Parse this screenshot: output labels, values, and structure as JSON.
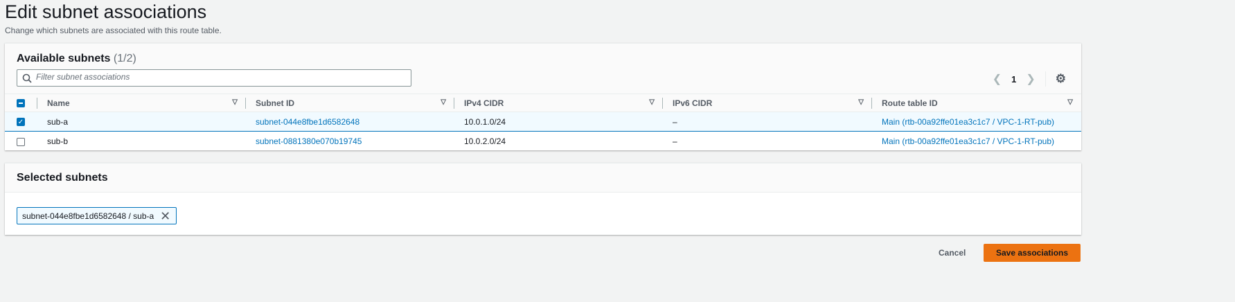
{
  "page": {
    "title": "Edit subnet associations",
    "description": "Change which subnets are associated with this route table."
  },
  "available": {
    "title": "Available subnets",
    "count": "(1/2)",
    "search_placeholder": "Filter subnet associations",
    "page": "1",
    "columns": [
      "Name",
      "Subnet ID",
      "IPv4 CIDR",
      "IPv6 CIDR",
      "Route table ID"
    ],
    "rows": [
      {
        "selected": true,
        "name": "sub-a",
        "subnet_id": "subnet-044e8fbe1d6582648",
        "ipv4": "10.0.1.0/24",
        "ipv6": "–",
        "route_table": "Main (rtb-00a92ffe01ea3c1c7 / VPC-1-RT-pub)"
      },
      {
        "selected": false,
        "name": "sub-b",
        "subnet_id": "subnet-0881380e070b19745",
        "ipv4": "10.0.2.0/24",
        "ipv6": "–",
        "route_table": "Main (rtb-00a92ffe01ea3c1c7 / VPC-1-RT-pub)"
      }
    ]
  },
  "selected": {
    "title": "Selected subnets",
    "tokens": [
      "subnet-044e8fbe1d6582648 / sub-a"
    ]
  },
  "actions": {
    "cancel": "Cancel",
    "save": "Save associations"
  }
}
